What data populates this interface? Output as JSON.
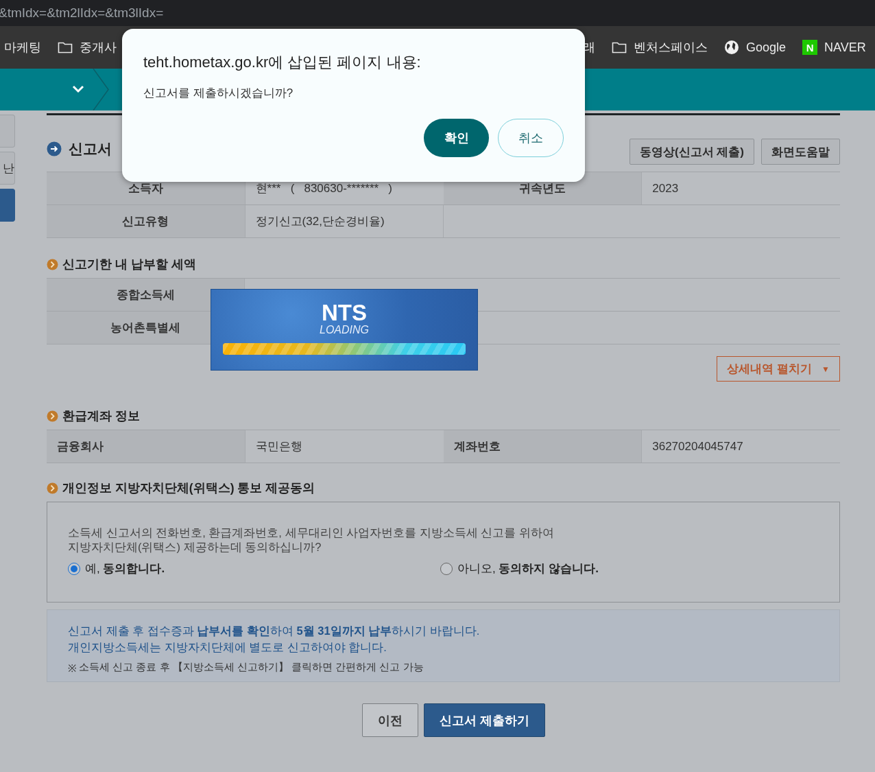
{
  "address_bar": {
    "url": "&tmIdx=&tm2lIdx=&tm3lIdx="
  },
  "bookmarks": [
    {
      "label": "마케팅",
      "kind": "plain"
    },
    {
      "label": "중개사",
      "kind": "folder"
    },
    {
      "label": "래",
      "kind": "plain"
    },
    {
      "label": "벤처스페이스",
      "kind": "folder"
    },
    {
      "label": "Google",
      "kind": "globe"
    },
    {
      "label": "NAVER",
      "kind": "naver",
      "icon_text": "N"
    }
  ],
  "side_tabs": [
    {
      "selected": false
    },
    {
      "label": "난",
      "selected": false
    },
    {
      "selected": true
    }
  ],
  "section_title": "신고서",
  "header_buttons": [
    "동영상(신고서 제출)",
    "화면도움말"
  ],
  "summary_rows": [
    [
      "소득자",
      "현***   (   830630-*******   )",
      "귀속년도",
      "2023"
    ],
    [
      "신고유형",
      "정기신고(32,단순경비율)"
    ]
  ],
  "tax_section": {
    "title": "신고기한 내 납부할 세액",
    "rows": [
      {
        "label": "종합소득세"
      },
      {
        "label": "농어촌특별세"
      }
    ],
    "detail_button": "상세내역 펼치기",
    "detail_caret": "▼"
  },
  "refund_section": {
    "title": "환급계좌 정보",
    "cells": [
      "금융회사",
      "국민은행",
      "계좌번호",
      "36270204045747"
    ]
  },
  "consent": {
    "title": "개인정보 지방자치단체(위택스) 통보 제공동의",
    "question": "소득세 신고서의 전화번호, 환급계좌번호, 세무대리인 사업자번호를 지방소득세 신고를 위하여\n지방자치단체(위택스) 제공하는데 동의하십니까?",
    "options": [
      {
        "label": "예, **동의합니다.**",
        "selected": true
      },
      {
        "label": "아니오, **동의하지 않습니다.**",
        "selected": false
      }
    ]
  },
  "notice": {
    "lines": [
      "신고서 제출 후 접수증과 **납부서를 확인**하여 **5월 31일까지 납부**하시기 바랍니다.",
      "개인지방소득세는 지방자치단체에 별도로 신고하여야 합니다."
    ],
    "note_mark": "※",
    "note": "소득세 신고 종료 후 【지방소득세 신고하기】 클릭하면 간편하게 신고 가능"
  },
  "footer_buttons": [
    {
      "label": "이전",
      "kind": "secondary"
    },
    {
      "label": "신고서 제출하기",
      "kind": "primary"
    }
  ],
  "loading": {
    "title": "NTS",
    "subtitle": "LOADING",
    "level": 1
  },
  "dialog": {
    "title": "teht.hometax.go.kr에 삽입된 페이지 내용:",
    "message": "신고서를 제출하시겠습니까?",
    "buttons": [
      {
        "label": "확인",
        "kind": "primary"
      },
      {
        "label": "취소",
        "kind": "secondary"
      }
    ]
  }
}
